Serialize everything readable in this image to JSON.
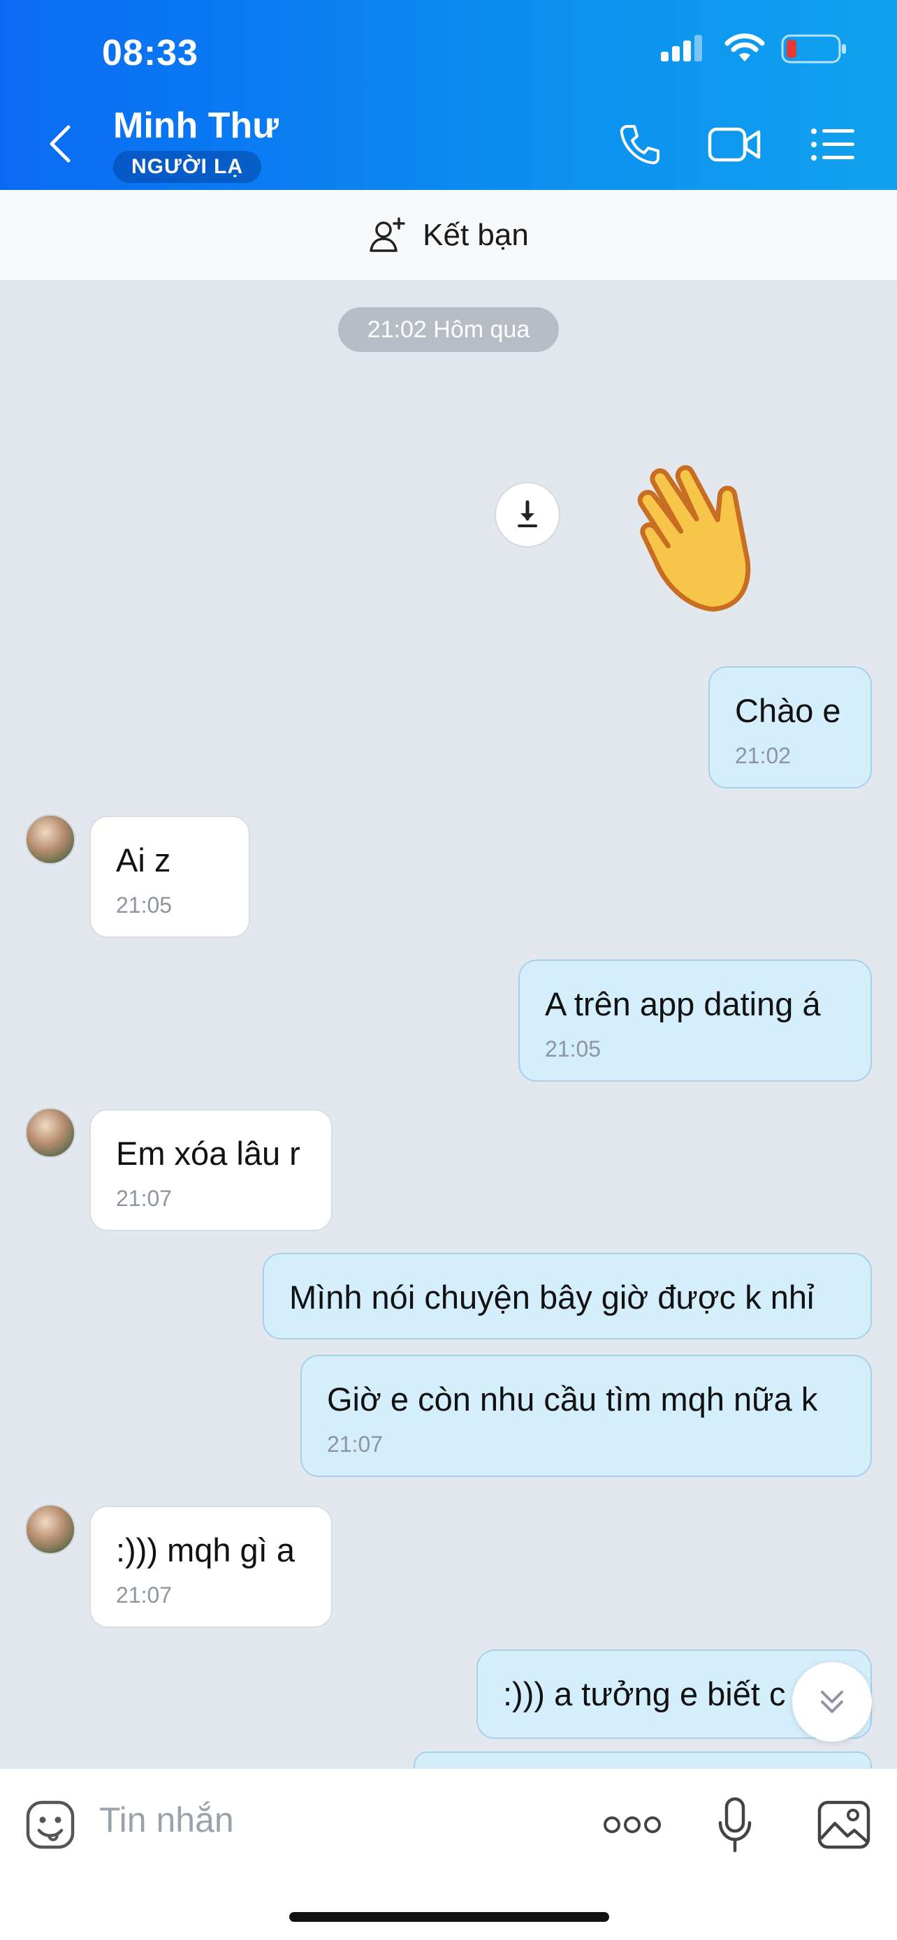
{
  "status_bar": {
    "time": "08:33",
    "battery_color": "#e53935"
  },
  "header": {
    "contact_name": "Minh Thư",
    "badge": "NGƯỜI LẠ",
    "icons": [
      "back-icon",
      "phone-icon",
      "video-icon",
      "list-icon"
    ]
  },
  "friend_bar": {
    "label": "Kết bạn"
  },
  "chat": {
    "date_pill": "21:02 Hôm qua",
    "messages": [
      {
        "dir": "out",
        "text": "Chào e",
        "time": "21:02"
      },
      {
        "dir": "in",
        "text": "Ai z",
        "time": "21:05"
      },
      {
        "dir": "out",
        "text": "A trên app dating á",
        "time": "21:05"
      },
      {
        "dir": "in",
        "text": "Em xóa lâu r",
        "time": "21:07"
      },
      {
        "dir": "out",
        "text": "Mình nói chuyện bây giờ được k nhỉ",
        "time": ""
      },
      {
        "dir": "out",
        "text": "Giờ e còn nhu cầu tìm mqh nữa k",
        "time": "21:07"
      },
      {
        "dir": "in",
        "text": ":))) mqh gì a",
        "time": "21:07"
      },
      {
        "dir": "out",
        "text": ":))) a tưởng e biết c",
        "time": ""
      }
    ]
  },
  "composer": {
    "placeholder": "Tin nhắn"
  },
  "colors": {
    "header_blue": "#0a6af3",
    "outgoing_bubble": "#d4eefc",
    "incoming_bubble": "#ffffff"
  }
}
